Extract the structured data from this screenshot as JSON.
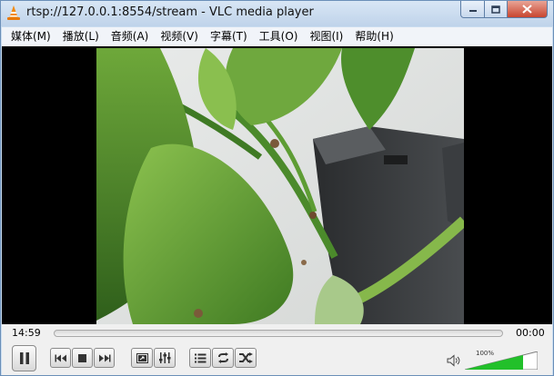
{
  "window": {
    "title": "rtsp://127.0.0.1:8554/stream - VLC media player"
  },
  "menu": [
    {
      "label": "媒体(M)"
    },
    {
      "label": "播放(L)"
    },
    {
      "label": "音频(A)"
    },
    {
      "label": "视频(V)"
    },
    {
      "label": "字幕(T)"
    },
    {
      "label": "工具(O)"
    },
    {
      "label": "视图(I)"
    },
    {
      "label": "帮助(H)"
    }
  ],
  "playback": {
    "elapsed": "14:59",
    "remaining": "00:00",
    "seek_fraction": 0
  },
  "volume": {
    "label": "100%",
    "level": 1.0,
    "color": "#22c02a"
  },
  "icons": {
    "play_pause": "pause-icon",
    "previous": "previous-icon",
    "stop": "stop-icon",
    "next": "next-icon",
    "fullscreen": "fullscreen-icon",
    "extended": "equalizer-icon",
    "playlist": "playlist-icon",
    "loop": "loop-icon",
    "shuffle": "shuffle-icon",
    "volume": "speaker-icon"
  },
  "colors": {
    "close_button": "#c8452f",
    "title_bar": "#c9dcf0",
    "video_background": "#000000"
  }
}
